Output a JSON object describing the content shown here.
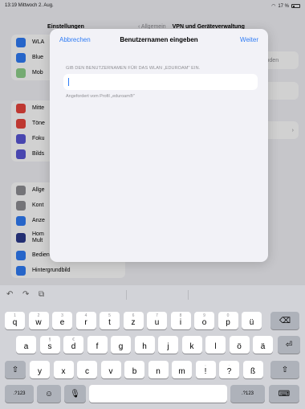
{
  "status_bar": {
    "time": "13:19  Mittwoch 2. Aug.",
    "battery": "17 %"
  },
  "sidebar": {
    "title": "Einstellungen",
    "group1": [
      {
        "label": "WLA",
        "icon": "wifi-icon",
        "color": "#2f7cf6"
      },
      {
        "label": "Blue",
        "icon": "bluetooth-icon",
        "color": "#2f7cf6"
      },
      {
        "label": "Mob",
        "icon": "cellular-icon",
        "color": "#8fd18c"
      }
    ],
    "group2": [
      {
        "label": "Mitte",
        "icon": "notification-icon",
        "color": "#e8453c"
      },
      {
        "label": "Töne",
        "icon": "sound-icon",
        "color": "#e8453c"
      },
      {
        "label": "Foku",
        "icon": "moon-icon",
        "color": "#5856d6"
      },
      {
        "label": "Bilds",
        "icon": "hourglass-icon",
        "color": "#5856d6"
      }
    ],
    "group3": [
      {
        "label": "Allge",
        "icon": "gear-icon",
        "color": "#8e8e93"
      },
      {
        "label": "Kont",
        "icon": "control-center-icon",
        "color": "#8e8e93"
      },
      {
        "label": "Anze",
        "icon": "display-icon",
        "color": "#2f7cf6"
      },
      {
        "label": "Hom",
        "label2": "Mult",
        "icon": "home-screen-icon",
        "color": "#2b3a8c"
      },
      {
        "label": "Bedienungshilfen",
        "icon": "accessibility-icon",
        "color": "#2f7cf6"
      },
      {
        "label": "Hintergrundbild",
        "icon": "wallpaper-icon",
        "color": "#2f7cf6"
      }
    ]
  },
  "detail": {
    "back_label": "Allgemein",
    "title": "VPN und Geräteverwaltung",
    "card1": "verbunden",
    "card2": "en ...",
    "card3": "›"
  },
  "modal": {
    "cancel_label": "Abbrechen",
    "title": "Benutzernamen eingeben",
    "next_label": "Weiter",
    "section_label": "GIB DEN BENUTZERNAMEN FÜR DAS WLAN „EDUROAM\" EIN.",
    "input_value": "",
    "footnote": "Angefordert vom Profil „eduroam®\""
  },
  "keyboard": {
    "toolbar": {
      "undo": "↶",
      "redo": "↷",
      "paste": "⧉"
    },
    "row1": [
      {
        "ch": "q",
        "hint": "1"
      },
      {
        "ch": "w",
        "hint": "2"
      },
      {
        "ch": "e",
        "hint": "3"
      },
      {
        "ch": "r",
        "hint": "4"
      },
      {
        "ch": "t",
        "hint": "5"
      },
      {
        "ch": "z",
        "hint": "6"
      },
      {
        "ch": "u",
        "hint": "7"
      },
      {
        "ch": "i",
        "hint": "8"
      },
      {
        "ch": "o",
        "hint": "9"
      },
      {
        "ch": "p",
        "hint": "0"
      },
      {
        "ch": "ü",
        "hint": ""
      }
    ],
    "row2": [
      {
        "ch": "a",
        "hint": ""
      },
      {
        "ch": "s",
        "hint": "§"
      },
      {
        "ch": "d",
        "hint": "€"
      },
      {
        "ch": "f",
        "hint": ""
      },
      {
        "ch": "g",
        "hint": ""
      },
      {
        "ch": "h",
        "hint": ""
      },
      {
        "ch": "j",
        "hint": ""
      },
      {
        "ch": "k",
        "hint": ""
      },
      {
        "ch": "l",
        "hint": ""
      },
      {
        "ch": "ö",
        "hint": ""
      },
      {
        "ch": "ä",
        "hint": ""
      }
    ],
    "row3": [
      {
        "ch": "y",
        "hint": ""
      },
      {
        "ch": "x",
        "hint": ""
      },
      {
        "ch": "c",
        "hint": ""
      },
      {
        "ch": "v",
        "hint": ""
      },
      {
        "ch": "b",
        "hint": ""
      },
      {
        "ch": "n",
        "hint": ""
      },
      {
        "ch": "m",
        "hint": ""
      },
      {
        "ch": "!",
        "hint": ","
      },
      {
        "ch": "?",
        "hint": "."
      },
      {
        "ch": "ß",
        "hint": ""
      }
    ],
    "delete": "⌫",
    "return": "⏎",
    "shift": "⇧",
    "numbers_left": ".?123",
    "numbers_right": ".?123",
    "emoji": "☺",
    "mic": "🎙",
    "hide": "⌨",
    "space": ""
  }
}
